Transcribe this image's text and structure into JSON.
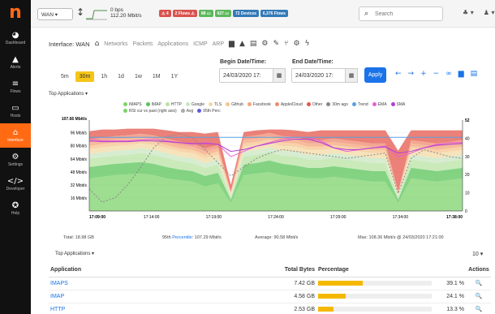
{
  "sidebar": {
    "logo": "n",
    "items": [
      {
        "icon": "◕",
        "label": "Dashboard"
      },
      {
        "icon": "▲",
        "label": "Alerts"
      },
      {
        "icon": "≡",
        "label": "Flows"
      },
      {
        "icon": "▭",
        "label": "Hosts"
      },
      {
        "icon": "⌂",
        "label": "Interface"
      },
      {
        "icon": "⚙",
        "label": "Settings"
      },
      {
        "icon": "</>",
        "label": "Developer"
      },
      {
        "icon": "✪",
        "label": "Help"
      }
    ]
  },
  "topbar": {
    "interface_selector": "WAN ▾",
    "updown_icon": "↕",
    "rate_up": "0 bps",
    "rate_down": "112.20 Mbit/s",
    "badges": [
      {
        "text": "⚠ 4",
        "color": "#d9534f"
      },
      {
        "text": "2 Flows ⚠",
        "color": "#d9534f"
      },
      {
        "text": "88 ▭",
        "color": "#5cb85c"
      },
      {
        "text": "627 ▭",
        "color": "#5cb85c"
      },
      {
        "text": "72 Devices",
        "color": "#337ab7"
      },
      {
        "text": "6,376 Flows",
        "color": "#337ab7"
      }
    ],
    "search_placeholder": "Search",
    "alert_menu": "♣ ▾",
    "user_menu": "♟ ▾"
  },
  "iface_nav": {
    "title": "Interface: WAN",
    "home_icon": "⌂",
    "links": [
      "Networks",
      "Packets",
      "Applications",
      "ICMP",
      "ARP"
    ],
    "icons": [
      "▆",
      "▲",
      "▤",
      "⚙",
      "✎",
      "⑂",
      "⚙",
      "ϟ"
    ]
  },
  "time": {
    "ranges": [
      "5m",
      "30m",
      "1h",
      "1d",
      "1w",
      "1M",
      "1Y"
    ],
    "active": "30m",
    "begin_label": "Begin Date/Time:",
    "begin_value": "24/03/2020 17:",
    "end_label": "End Date/Time:",
    "end_value": "24/03/2020 17:",
    "calendar_icon": "▦",
    "apply": "Apply",
    "nav_icons": [
      "←",
      "→",
      "+",
      "−",
      "∞",
      "▆",
      "▤"
    ]
  },
  "chart_dropdown": "Top Applications ▾",
  "chart_data": {
    "type": "area",
    "title": "",
    "ylabel_left_top": "107.66 Mbit/s",
    "y_ticks_left": [
      "96 Mbit/s",
      "80 Mbit/s",
      "64 Mbit/s",
      "48 Mbit/s",
      "32 Mbit/s",
      "16 Mbit/s"
    ],
    "y_ticks_right": [
      "52",
      "40",
      "30",
      "20",
      "10",
      "0"
    ],
    "x_ticks": [
      "17:09:00",
      "17:14:00",
      "17:19:00",
      "17:24:00",
      "17:29:00",
      "17:34:00",
      "17:38:00"
    ],
    "ylim": [
      0,
      107.66
    ],
    "legend": [
      {
        "name": "IMAPS",
        "color": "#7ed36b"
      },
      {
        "name": "IMAP",
        "color": "#59c459"
      },
      {
        "name": "HTTP",
        "color": "#b8e3a3"
      },
      {
        "name": "Google",
        "color": "#c9e6c2"
      },
      {
        "name": "TLS",
        "color": "#f3d9a4"
      },
      {
        "name": "Github",
        "color": "#f7c48d"
      },
      {
        "name": "Facebook",
        "color": "#f4a67a"
      },
      {
        "name": "AppleiCloud",
        "color": "#ef8a6f"
      },
      {
        "name": "Other",
        "color": "#e4574b"
      },
      {
        "name": "30m ago",
        "color": "#888888"
      },
      {
        "name": "Trend",
        "color": "#5aa0e0"
      },
      {
        "name": "EMA",
        "color": "#e85fd2"
      },
      {
        "name": "SMA",
        "color": "#b03dd6"
      },
      {
        "name": "RSI cur vs past (right axis)",
        "color": "#7ed36b"
      },
      {
        "name": "Avg",
        "color": "#aaaaaa"
      },
      {
        "name": "95th Perc",
        "color": "#5a5adf"
      }
    ],
    "x": [
      0,
      1,
      2,
      3,
      4,
      5,
      6,
      7,
      8,
      9,
      10,
      11,
      12,
      13,
      14,
      15,
      16,
      17,
      18,
      19,
      20,
      21,
      22,
      23,
      24,
      25,
      26,
      27,
      28,
      29
    ],
    "series": [
      {
        "name": "IMAPS",
        "values": [
          40,
          42,
          44,
          45,
          46,
          44,
          40,
          38,
          36,
          30,
          34,
          10,
          44,
          46,
          48,
          44,
          42,
          40,
          40,
          42,
          40,
          38,
          36,
          36,
          10,
          40,
          38,
          36,
          38,
          40
        ]
      },
      {
        "name": "IMAP",
        "values": [
          14,
          14,
          14,
          14,
          14,
          14,
          14,
          13,
          13,
          13,
          13,
          4,
          13,
          13,
          14,
          14,
          14,
          13,
          13,
          13,
          13,
          13,
          13,
          13,
          4,
          13,
          13,
          13,
          13,
          13
        ]
      },
      {
        "name": "HTTP",
        "values": [
          10,
          10,
          10,
          10,
          11,
          11,
          11,
          10,
          10,
          10,
          10,
          3,
          10,
          10,
          10,
          10,
          11,
          10,
          10,
          10,
          10,
          10,
          10,
          10,
          3,
          10,
          10,
          10,
          10,
          10
        ]
      },
      {
        "name": "Google",
        "values": [
          6,
          6,
          6,
          6,
          6,
          6,
          6,
          6,
          6,
          6,
          6,
          2,
          6,
          6,
          6,
          6,
          6,
          6,
          6,
          6,
          6,
          6,
          6,
          6,
          2,
          6,
          6,
          6,
          6,
          6
        ]
      },
      {
        "name": "TLS",
        "values": [
          6,
          6,
          6,
          6,
          6,
          6,
          6,
          6,
          6,
          6,
          6,
          2,
          6,
          6,
          6,
          6,
          6,
          6,
          6,
          6,
          6,
          6,
          6,
          6,
          2,
          6,
          6,
          6,
          6,
          6
        ]
      },
      {
        "name": "Github",
        "values": [
          4,
          4,
          4,
          4,
          4,
          4,
          4,
          4,
          4,
          4,
          4,
          1,
          4,
          4,
          4,
          4,
          4,
          4,
          4,
          4,
          4,
          4,
          4,
          4,
          1,
          4,
          4,
          4,
          4,
          4
        ]
      },
      {
        "name": "Facebook",
        "values": [
          4,
          4,
          4,
          4,
          4,
          4,
          4,
          4,
          4,
          4,
          4,
          1,
          4,
          4,
          4,
          4,
          4,
          4,
          4,
          4,
          4,
          4,
          4,
          4,
          1,
          4,
          4,
          4,
          4,
          4
        ]
      },
      {
        "name": "AppleiCloud",
        "values": [
          4,
          4,
          4,
          4,
          4,
          4,
          4,
          4,
          4,
          4,
          4,
          1,
          4,
          4,
          4,
          4,
          4,
          4,
          4,
          4,
          4,
          4,
          4,
          4,
          1,
          4,
          4,
          4,
          4,
          4
        ]
      },
      {
        "name": "Other",
        "values": [
          10,
          10,
          8,
          8,
          6,
          8,
          10,
          12,
          14,
          18,
          16,
          8,
          6,
          6,
          4,
          8,
          8,
          10,
          12,
          10,
          12,
          14,
          16,
          16,
          50,
          12,
          14,
          16,
          14,
          12
        ]
      }
    ]
  },
  "stats": {
    "total": "Total: 18.98 GB",
    "perc_prefix": "95th",
    "perc_link": "Percentile",
    "perc_value": ": 107.29 Mbit/s",
    "average": "Average: 90.58 Mbit/s",
    "max": "Max: 108.36 Mbit/s @ 24/03/2020 17:21:00"
  },
  "table": {
    "dropdown": "Top Applications ▾",
    "page_size": "10 ▾",
    "headers": {
      "app": "Application",
      "bytes": "Total Bytes",
      "pct": "Percentage",
      "actions": "Actions"
    },
    "rows": [
      {
        "app": "IMAPS",
        "bytes": "7.42 GB",
        "pct": "39.1 %",
        "frac": 0.391
      },
      {
        "app": "IMAP",
        "bytes": "4.58 GB",
        "pct": "24.1 %",
        "frac": 0.241
      },
      {
        "app": "HTTP",
        "bytes": "2.53 GB",
        "pct": "13.3 %",
        "frac": 0.133
      }
    ],
    "action_icon": "🔍"
  }
}
